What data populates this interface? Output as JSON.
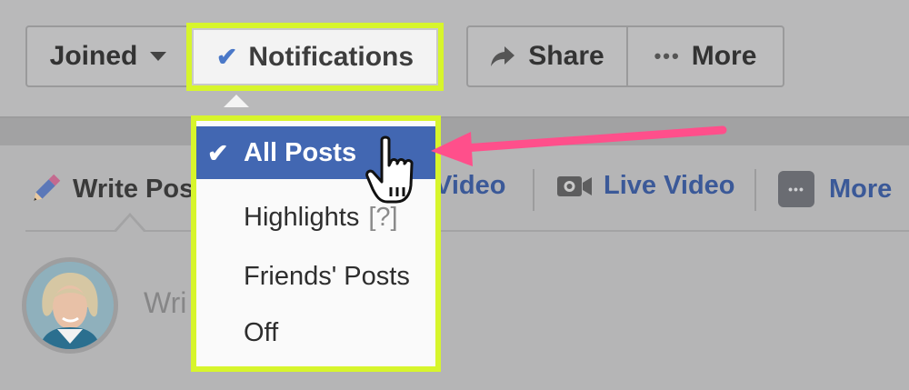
{
  "header": {
    "joined_label": "Joined",
    "notifications_label": "Notifications",
    "share_label": "Share",
    "more_label": "More"
  },
  "composer": {
    "tabs": [
      {
        "label": "Write Post"
      },
      {
        "label": "Video"
      },
      {
        "label": "Live Video"
      },
      {
        "label": "More"
      }
    ],
    "placeholder": "Wri"
  },
  "dropdown": {
    "items": [
      {
        "label": "All Posts",
        "selected": true
      },
      {
        "label": "Highlights",
        "suffix": "[?]"
      },
      {
        "label": "Friends' Posts"
      },
      {
        "label": "Off"
      }
    ]
  },
  "colors": {
    "highlight": "#d7f52c",
    "selected": "#4267b2",
    "arrow": "#ff4f8b",
    "link": "#3b5998"
  }
}
